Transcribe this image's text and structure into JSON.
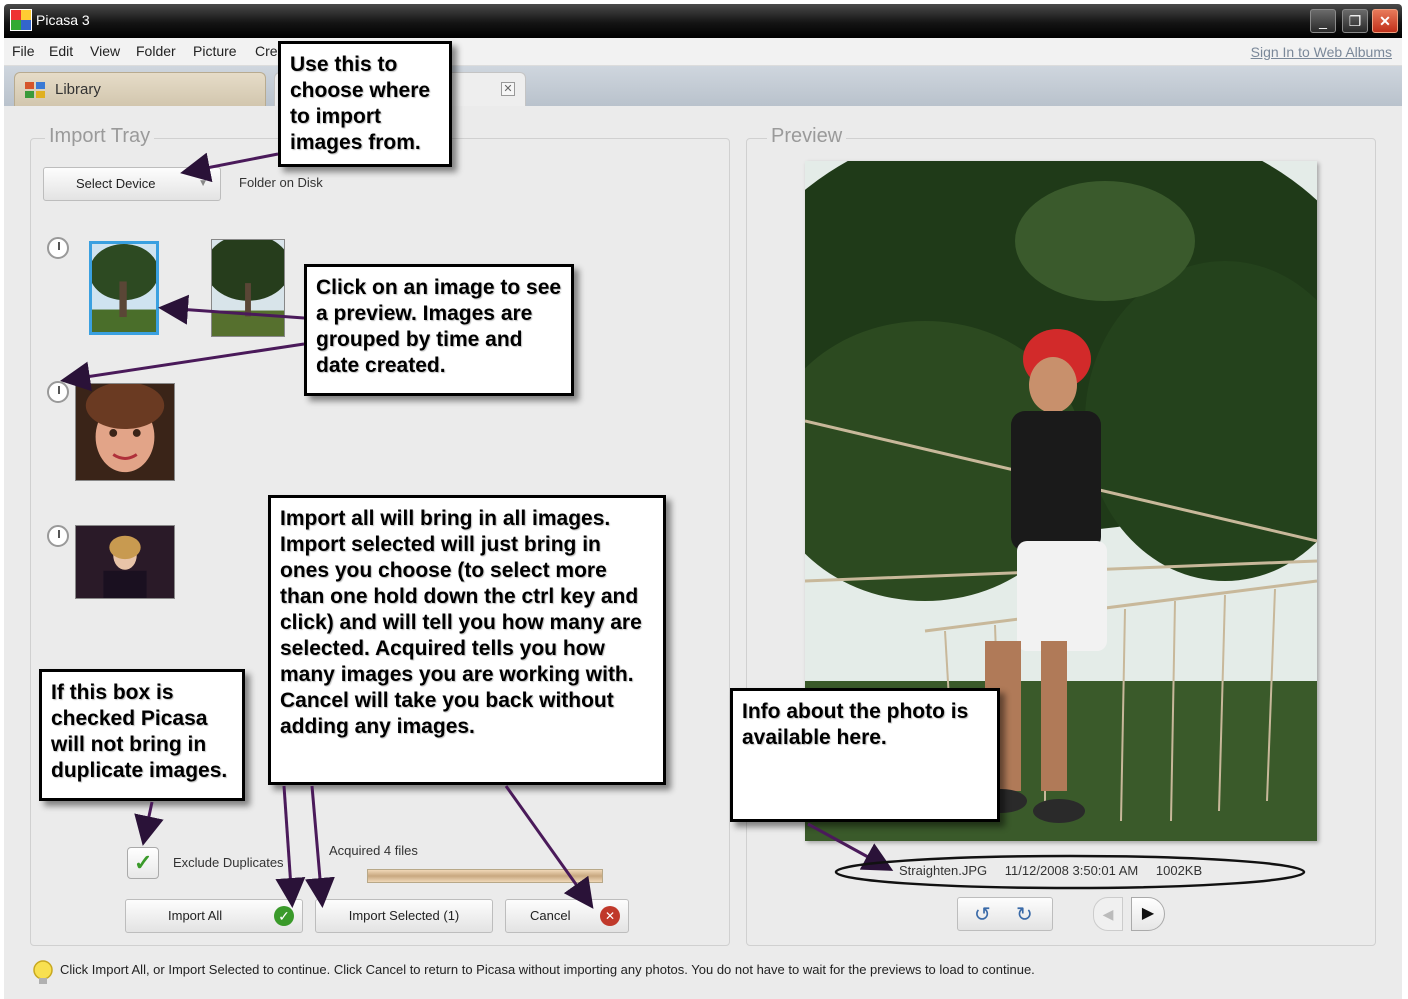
{
  "window": {
    "title": "Picasa 3",
    "minimize": "_",
    "restore": "❐",
    "close": "✕"
  },
  "menu": {
    "items": [
      "File",
      "Edit",
      "View",
      "Folder",
      "Picture",
      "Cre"
    ],
    "sign_in": "Sign In to Web Albums"
  },
  "tabs": {
    "library": "Library",
    "import_close": "✕"
  },
  "import_tray": {
    "title": "Import Tray",
    "select_device": "Select Device",
    "device_value": "Folder on Disk",
    "exclude_duplicates": "Exclude Duplicates",
    "exclude_checked": true,
    "acquired": "Acquired 4 files",
    "import_all": "Import All",
    "import_selected": "Import Selected (1)",
    "cancel": "Cancel"
  },
  "preview": {
    "title": "Preview",
    "filename": "Straighten.JPG",
    "datetime": "11/12/2008 3:50:01 AM",
    "size": "1002KB"
  },
  "hint": "Click Import All, or Import Selected to continue. Click Cancel to return to Picasa without importing any photos. You do not have to wait for the previews to load to continue.",
  "callouts": {
    "import_source": "Use this to choose where to import images from.",
    "click_image": "Click on an image to see a preview.  Images are grouped by time and date created.",
    "buttons": "Import all will bring in all images. Import selected will just bring in ones you choose (to select more than one hold down the ctrl key and click) and will tell you how many are selected.  Acquired tells you how many images you are working with. Cancel will take you back without adding any images.",
    "duplicates": "If this box is checked Picasa will not bring in duplicate images.",
    "info": "Info about the photo is available here."
  },
  "colors": {
    "accent_check": "#3a9a2a",
    "cancel_red": "#c0392b",
    "callout_arrow": "#4a1a5a",
    "selected_border": "#3aa0e0"
  }
}
